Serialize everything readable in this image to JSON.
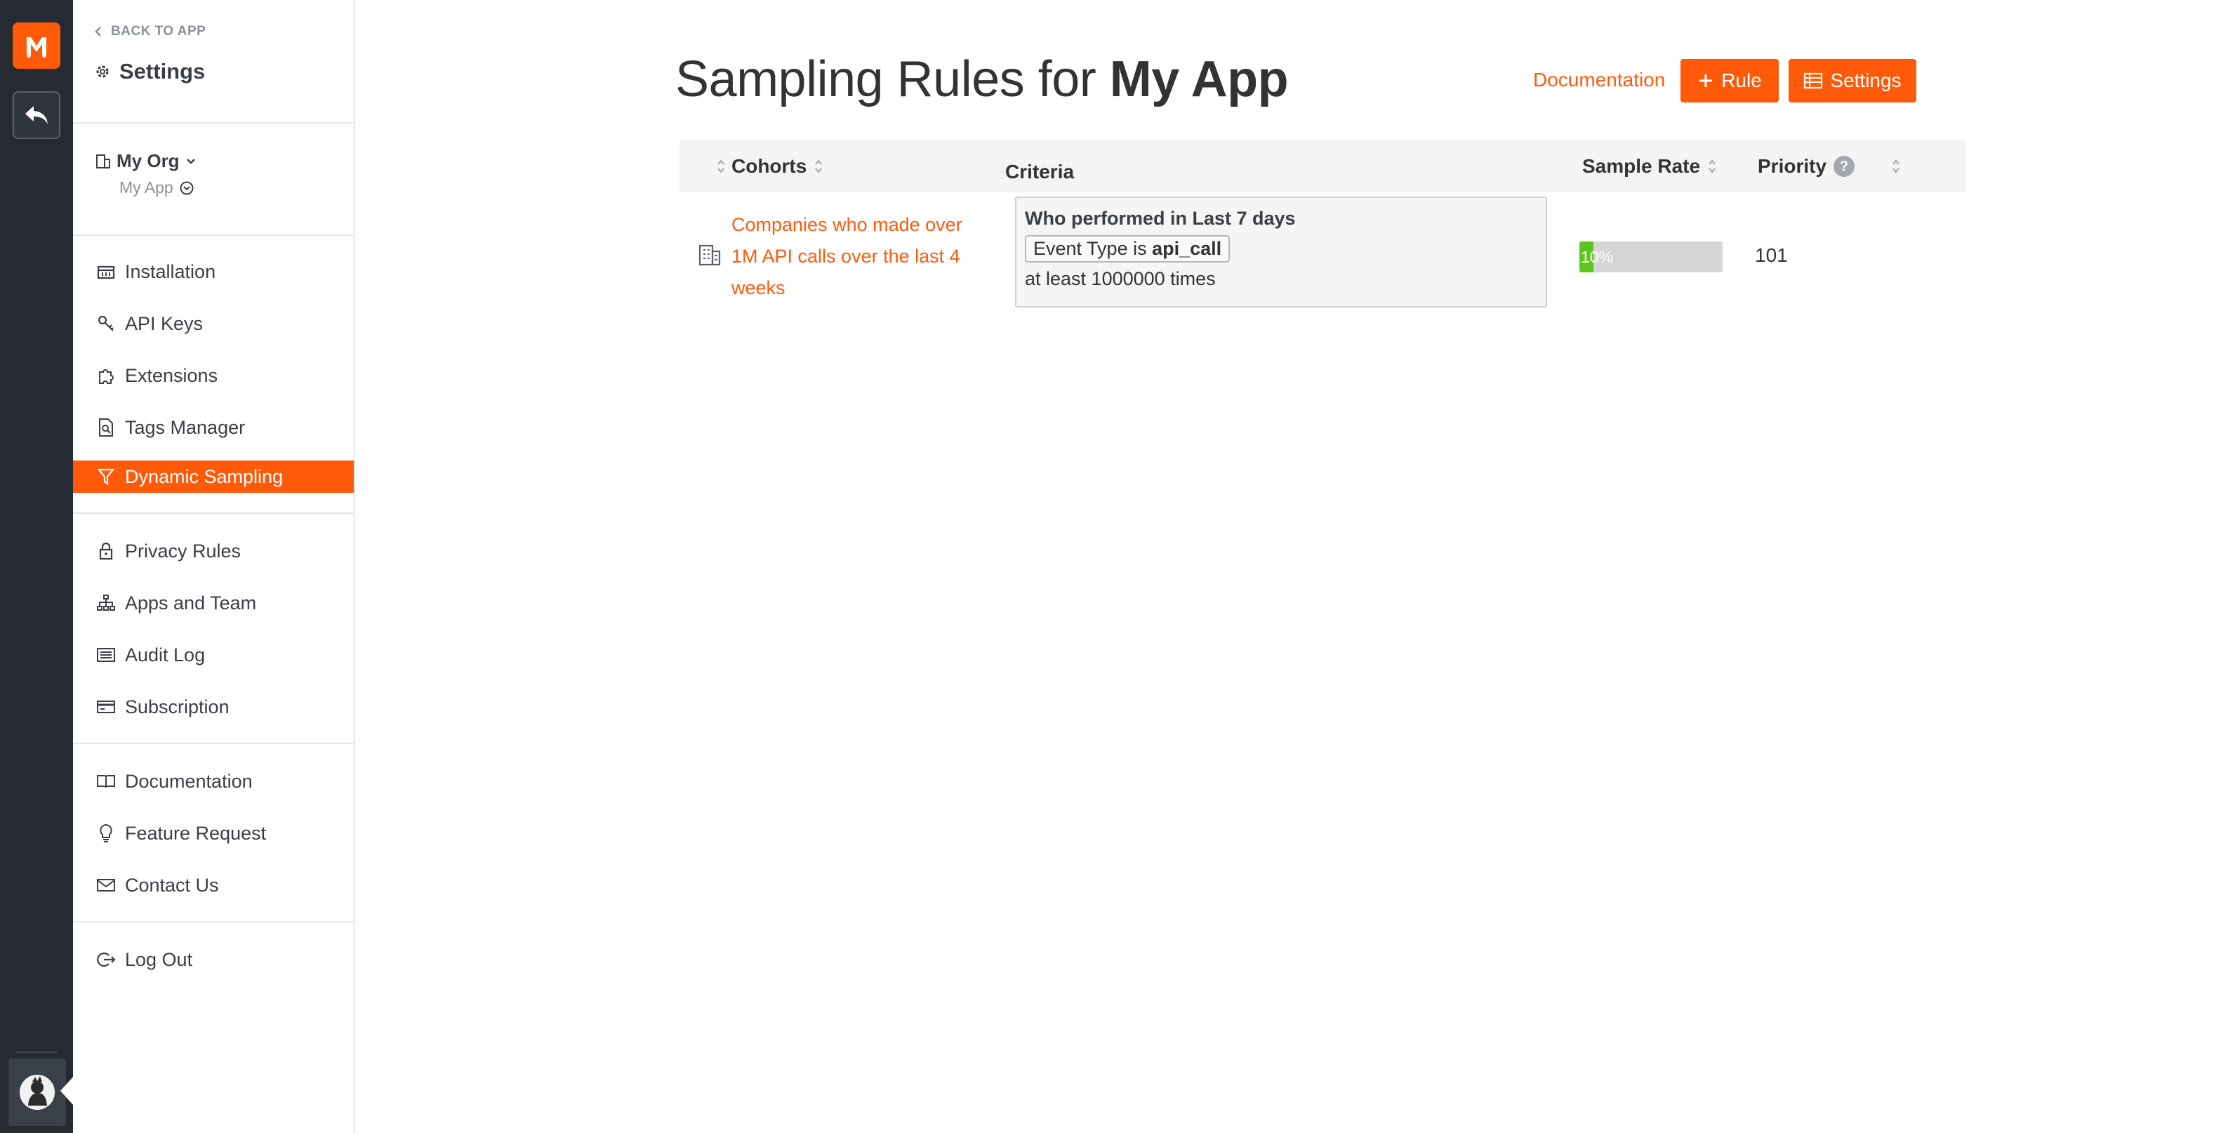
{
  "rail": {
    "logo_icon": "moesif-logo-icon",
    "back_icon": "reply-arrow-icon",
    "avatar_icon": "user-avatar-icon"
  },
  "sidebar": {
    "back_label": "BACK TO APP",
    "title": "Settings",
    "org_name": "My Org",
    "app_name": "My App",
    "groups": [
      [
        {
          "label": "Installation",
          "icon": "installation-icon"
        },
        {
          "label": "API Keys",
          "icon": "key-icon"
        },
        {
          "label": "Extensions",
          "icon": "puzzle-icon"
        },
        {
          "label": "Tags Manager",
          "icon": "tag-search-icon"
        },
        {
          "label": "Dynamic Sampling",
          "icon": "filter-icon",
          "active": true
        }
      ],
      [
        {
          "label": "Privacy Rules",
          "icon": "lock-icon"
        },
        {
          "label": "Apps and Team",
          "icon": "sitemap-icon"
        },
        {
          "label": "Audit Log",
          "icon": "list-icon"
        },
        {
          "label": "Subscription",
          "icon": "credit-card-icon"
        }
      ],
      [
        {
          "label": "Documentation",
          "icon": "book-icon"
        },
        {
          "label": "Feature Request",
          "icon": "lightbulb-icon"
        },
        {
          "label": "Contact Us",
          "icon": "envelope-icon"
        }
      ],
      [
        {
          "label": "Log Out",
          "icon": "logout-icon"
        }
      ]
    ]
  },
  "header": {
    "title_prefix": "Sampling Rules for",
    "title_app": "My App",
    "doc_link": "Documentation",
    "rule_button": "Rule",
    "settings_button": "Settings"
  },
  "table": {
    "columns": {
      "cohorts": "Cohorts",
      "criteria": "Criteria",
      "sample_rate": "Sample Rate",
      "priority": "Priority"
    },
    "rows": [
      {
        "cohort": "Companies who made over 1M API calls over the last 4 weeks",
        "criteria_heading": "Who performed in Last 7 days",
        "chip_prefix": "Event Type is",
        "chip_value": "api_call",
        "criteria_tail": "at least 1000000 times",
        "sample_rate_label": "10%",
        "sample_rate_value": 0.1,
        "priority": "101"
      }
    ]
  },
  "colors": {
    "accent": "#ff5a0a",
    "rail": "#262b33",
    "rate_fill": "#5cc51e"
  }
}
